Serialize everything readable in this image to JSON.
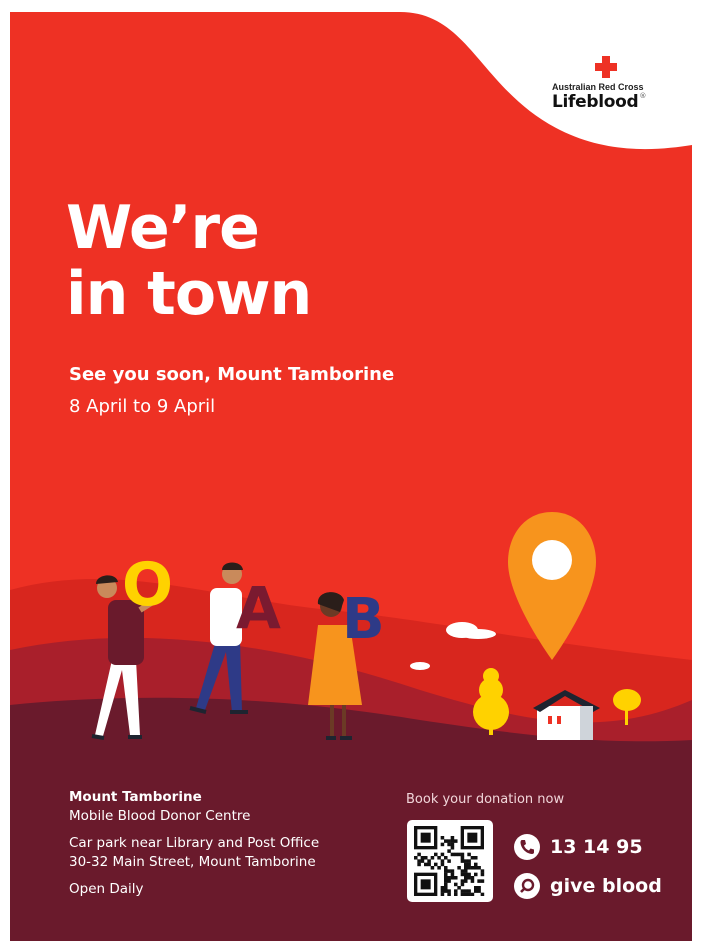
{
  "logo": {
    "organization": "Australian Red Cross",
    "brand": "Lifeblood",
    "registered_mark": "®"
  },
  "headline": {
    "line1": "We’re",
    "line2": "in town"
  },
  "subtitle": "See you soon, Mount Tamborine",
  "dates": "8 April to 9 April",
  "illustration": {
    "letters": [
      "O",
      "A",
      "B"
    ],
    "icons": [
      "location-pin-icon",
      "house-icon",
      "tree-icon",
      "cloud-icon"
    ]
  },
  "venue": {
    "title": "Mount Tamborine",
    "centre": "Mobile Blood Donor Centre",
    "address_line1": "Car park near Library and Post Office",
    "address_line2": "30-32 Main Street, Mount Tamborine",
    "hours": "Open Daily"
  },
  "booking": {
    "prompt": "Book your donation now",
    "phone": "13 14 95",
    "search": "give blood"
  },
  "colors": {
    "red": "#ee3124",
    "maroon": "#6a1a2c",
    "orange_pin": "#f7941d",
    "yellow": "#ffd200",
    "navy": "#2e3a87"
  }
}
